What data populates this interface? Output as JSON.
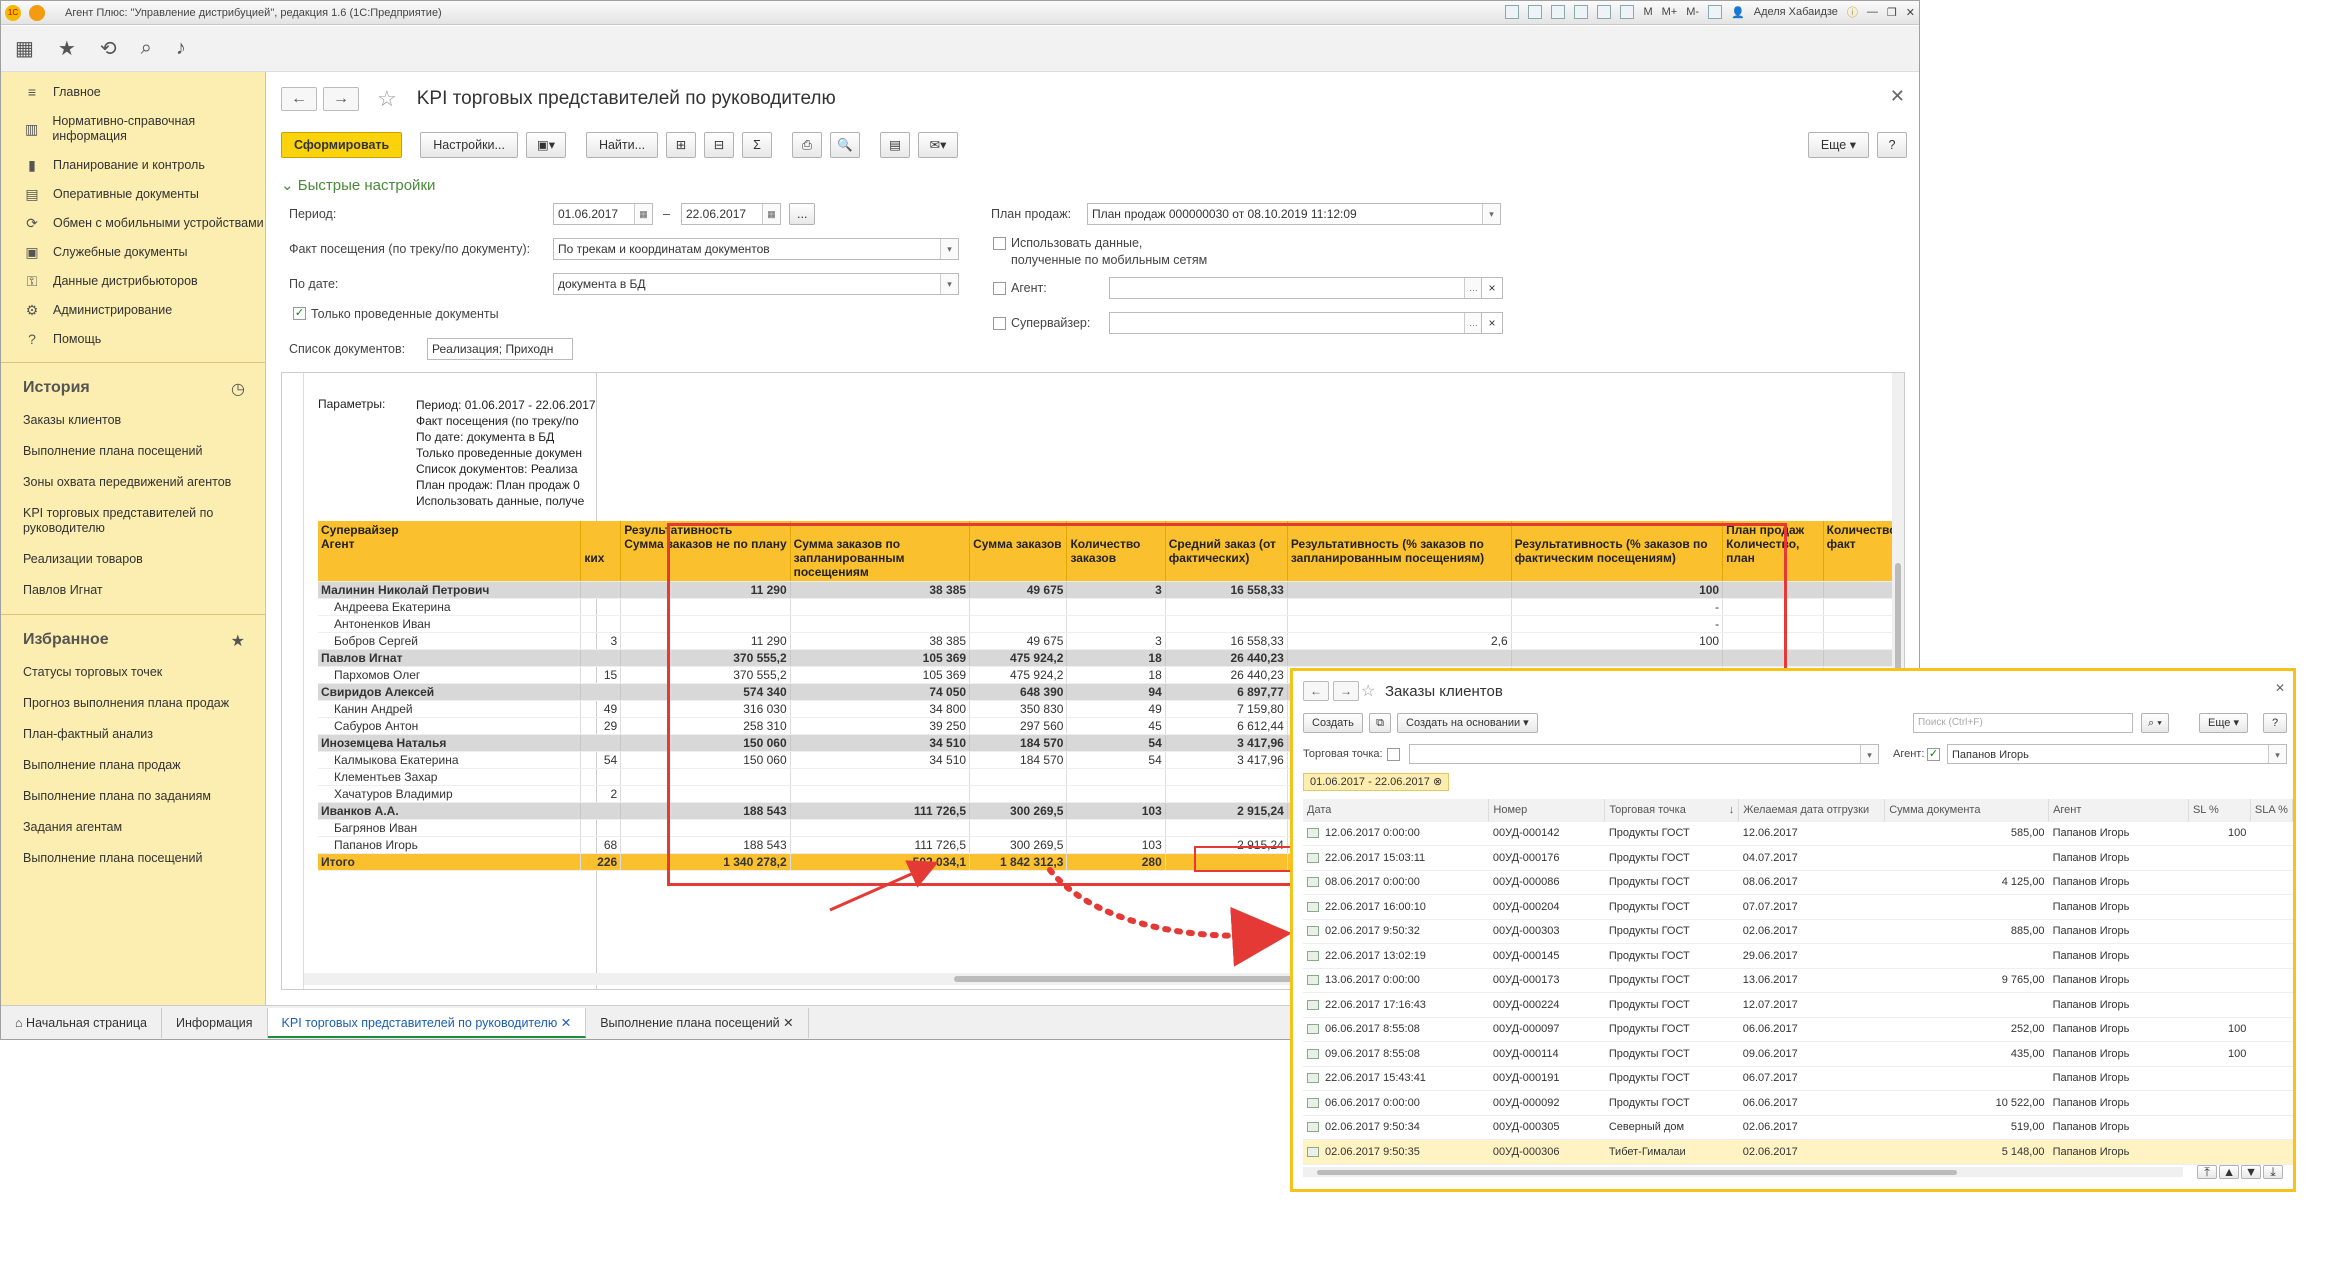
{
  "window": {
    "title": "Агент Плюс: \"Управление дистрибуцией\", редакция 1.6  (1С:Предприятие)",
    "user": "Аделя Хабаидзе",
    "toolbar_buttons": [
      "M",
      "M+",
      "M-"
    ]
  },
  "sidebar": {
    "sections": [
      {
        "label": "Главное",
        "icon": "menu-icon"
      },
      {
        "label": "Нормативно-справочная информация",
        "icon": "directory-icon"
      },
      {
        "label": "Планирование и контроль",
        "icon": "chart-icon"
      },
      {
        "label": "Оперативные документы",
        "icon": "document-icon"
      },
      {
        "label": "Обмен с мобильными устройствами",
        "icon": "sync-icon"
      },
      {
        "label": "Служебные документы",
        "icon": "service-icon"
      },
      {
        "label": "Данные дистрибьюторов",
        "icon": "data-icon"
      },
      {
        "label": "Администрирование",
        "icon": "gear-icon"
      },
      {
        "label": "Помощь",
        "icon": "help-icon"
      }
    ],
    "history_title": "История",
    "history": [
      "Заказы клиентов",
      "Выполнение плана посещений",
      "Зоны охвата передвижений агентов",
      "KPI торговых представителей по руководителю",
      "Реализации товаров",
      "Павлов Игнат"
    ],
    "favorites_title": "Избранное",
    "favorites": [
      "Статусы торговых точек",
      "Прогноз выполнения плана продаж",
      "План-фактный анализ",
      "Выполнение плана продаж",
      "Выполнение плана по заданиям",
      "Задания агентам",
      "Выполнение плана посещений"
    ]
  },
  "report_form": {
    "title": "KPI торговых представителей по руководителю",
    "buttons": {
      "generate": "Сформировать",
      "settings": "Настройки...",
      "find": "Найти...",
      "more": "Еще",
      "help": "?",
      "sum": "Σ"
    },
    "quick_settings": "Быстрые настройки",
    "period_label": "Период:",
    "period_from": "01.06.2017",
    "period_dash": "–",
    "period_to": "22.06.2017",
    "period_more": "...",
    "fact_label": "Факт посещения (по треку/по документу):",
    "fact_value": "По трекам и координатам документов",
    "bydate_label": "По дате:",
    "bydate_value": "документа в БД",
    "only_posted": "Только проведенные документы",
    "doclist_label": "Список документов:",
    "doclist_value": "Реализация; Приходн",
    "plan_label": "План продаж:",
    "plan_value": "План продаж 000000030 от 08.10.2019 11:12:09",
    "use_mobile": "Использовать данные,",
    "use_mobile2": "полученные по мобильным сетям",
    "agent_label": "Агент:",
    "supervisor_label": "Супервайзер:"
  },
  "report": {
    "params_label": "Параметры:",
    "params": [
      "Период: 01.06.2017 - 22.06.2017",
      "Факт посещения (по треку/по",
      "По дате: документа в БД",
      "Только проведенные докумен",
      "Список документов: Реализа",
      "План продаж: План продаж 0",
      "Использовать данные, получе"
    ],
    "headers": {
      "supervisor": "Супервайзер",
      "agent": "Агент",
      "col_kih": "ких",
      "results": "Результативность",
      "c1": "Сумма заказов не по плану",
      "c2": "Сумма заказов по запланированным посещениям",
      "c3": "Сумма заказов",
      "c4": "Количество заказов",
      "c5": "Средний заказ (от фактических)",
      "c6": "Результативность (% заказов по запланированным посещениям)",
      "c7": "Результативность (% заказов по фактическим посещениям)",
      "c8": "План продаж Количество, план",
      "c9": "Количество, факт"
    },
    "rows": [
      {
        "type": "grp",
        "name": "Малинин Николай Петрович",
        "k": "",
        "c1": "11 290",
        "c2": "38 385",
        "c3": "49 675",
        "c4": "3",
        "c5": "16 558,33",
        "c6": "",
        "c7": "100"
      },
      {
        "type": "row",
        "name": "Андреева Екатерина",
        "k": "",
        "c1": "",
        "c2": "",
        "c3": "",
        "c4": "",
        "c5": "",
        "c6": "",
        "c7": "-"
      },
      {
        "type": "row",
        "name": "Антоненков Иван",
        "k": "",
        "c1": "",
        "c2": "",
        "c3": "",
        "c4": "",
        "c5": "",
        "c6": "",
        "c7": "-"
      },
      {
        "type": "row",
        "name": "Бобров Сергей",
        "k": "3",
        "c1": "11 290",
        "c2": "38 385",
        "c3": "49 675",
        "c4": "3",
        "c5": "16 558,33",
        "c6": "2,6",
        "c7": "100"
      },
      {
        "type": "grp",
        "name": "Павлов Игнат",
        "k": "",
        "c1": "370 555,2",
        "c2": "105 369",
        "c3": "475 924,2",
        "c4": "18",
        "c5": "26 440,23",
        "c6": "",
        "c7": ""
      },
      {
        "type": "row",
        "name": "Пархомов Олег",
        "k": "15",
        "c1": "370 555,2",
        "c2": "105 369",
        "c3": "475 924,2",
        "c4": "18",
        "c5": "26 440,23",
        "c6": "",
        "c7": ""
      },
      {
        "type": "grp",
        "name": "Свиридов Алексей",
        "k": "",
        "c1": "574 340",
        "c2": "74 050",
        "c3": "648 390",
        "c4": "94",
        "c5": "6 897,77",
        "c6": "",
        "c7": ""
      },
      {
        "type": "row",
        "name": "Канин Андрей",
        "k": "49",
        "c1": "316 030",
        "c2": "34 800",
        "c3": "350 830",
        "c4": "49",
        "c5": "7 159,80",
        "c6": "",
        "c7": ""
      },
      {
        "type": "row",
        "name": "Сабуров Антон",
        "k": "29",
        "c1": "258 310",
        "c2": "39 250",
        "c3": "297 560",
        "c4": "45",
        "c5": "6 612,44",
        "c6": "",
        "c7": ""
      },
      {
        "type": "grp",
        "name": "Иноземцева Наталья",
        "k": "",
        "c1": "150 060",
        "c2": "34 510",
        "c3": "184 570",
        "c4": "54",
        "c5": "3 417,96",
        "c6": "",
        "c7": ""
      },
      {
        "type": "row",
        "name": "Калмыкова Екатерина",
        "k": "54",
        "c1": "150 060",
        "c2": "34 510",
        "c3": "184 570",
        "c4": "54",
        "c5": "3 417,96",
        "c6": "",
        "c7": ""
      },
      {
        "type": "row",
        "name": "Клементьев Захар",
        "k": "",
        "c1": "",
        "c2": "",
        "c3": "",
        "c4": "",
        "c5": "",
        "c6": "",
        "c7": ""
      },
      {
        "type": "row",
        "name": "Хачатуров Владимир",
        "k": "2",
        "c1": "",
        "c2": "",
        "c3": "",
        "c4": "",
        "c5": "",
        "c6": "",
        "c7": ""
      },
      {
        "type": "grp",
        "name": "Иванков А.А.",
        "k": "",
        "c1": "188 543",
        "c2": "111 726,5",
        "c3": "300 269,5",
        "c4": "103",
        "c5": "2 915,24",
        "c6": "",
        "c7": ""
      },
      {
        "type": "row",
        "name": "Багрянов Иван",
        "k": "",
        "c1": "",
        "c2": "",
        "c3": "",
        "c4": "",
        "c5": "",
        "c6": "",
        "c7": ""
      },
      {
        "type": "row",
        "name": "Папанов Игорь",
        "k": "68",
        "c1": "188 543",
        "c2": "111 726,5",
        "c3": "300 269,5",
        "c4": "103",
        "c5": "2 915,24",
        "c6": "",
        "c7": ""
      },
      {
        "type": "tot",
        "name": "Итого",
        "k": "226",
        "c1": "1 340 278,2",
        "c2": "502 034,1",
        "c3": "1 842 312,3",
        "c4": "280",
        "c5": "",
        "c6": "",
        "c7": ""
      }
    ]
  },
  "tabs": [
    "Начальная страница",
    "Информация",
    "KPI торговых представителей по руководителю",
    "Выполнение плана посещений"
  ],
  "orders": {
    "title": "Заказы клиентов",
    "create": "Создать",
    "create_basis": "Создать на основании",
    "search_placeholder": "Поиск (Ctrl+F)",
    "more": "Еще",
    "help": "?",
    "outlet_label": "Торговая точка:",
    "agent_label": "Агент:",
    "agent_value": "Папанов Игорь",
    "period_filter": "01.06.2017 - 22.06.2017",
    "columns": [
      "Дата",
      "Номер",
      "Торговая точка",
      "Желаемая дата отгрузки",
      "Сумма документа",
      "Агент",
      "SL %",
      "SLA %"
    ],
    "rows": [
      [
        "12.06.2017 0:00:00",
        "00УД-000142",
        "Продукты ГОСТ",
        "12.06.2017",
        "585,00",
        "Папанов Игорь",
        "100",
        ""
      ],
      [
        "22.06.2017 15:03:11",
        "00УД-000176",
        "Продукты ГОСТ",
        "04.07.2017",
        "",
        "Папанов Игорь",
        "",
        ""
      ],
      [
        "08.06.2017 0:00:00",
        "00УД-000086",
        "Продукты ГОСТ",
        "08.06.2017",
        "4 125,00",
        "Папанов Игорь",
        "",
        ""
      ],
      [
        "22.06.2017 16:00:10",
        "00УД-000204",
        "Продукты ГОСТ",
        "07.07.2017",
        "",
        "Папанов Игорь",
        "",
        ""
      ],
      [
        "02.06.2017 9:50:32",
        "00УД-000303",
        "Продукты ГОСТ",
        "02.06.2017",
        "885,00",
        "Папанов Игорь",
        "",
        ""
      ],
      [
        "22.06.2017 13:02:19",
        "00УД-000145",
        "Продукты ГОСТ",
        "29.06.2017",
        "",
        "Папанов Игорь",
        "",
        ""
      ],
      [
        "13.06.2017 0:00:00",
        "00УД-000173",
        "Продукты ГОСТ",
        "13.06.2017",
        "9 765,00",
        "Папанов Игорь",
        "",
        ""
      ],
      [
        "22.06.2017 17:16:43",
        "00УД-000224",
        "Продукты ГОСТ",
        "12.07.2017",
        "",
        "Папанов Игорь",
        "",
        ""
      ],
      [
        "06.06.2017 8:55:08",
        "00УД-000097",
        "Продукты ГОСТ",
        "06.06.2017",
        "252,00",
        "Папанов Игорь",
        "100",
        ""
      ],
      [
        "09.06.2017 8:55:08",
        "00УД-000114",
        "Продукты ГОСТ",
        "09.06.2017",
        "435,00",
        "Папанов Игорь",
        "100",
        ""
      ],
      [
        "22.06.2017 15:43:41",
        "00УД-000191",
        "Продукты ГОСТ",
        "06.07.2017",
        "",
        "Папанов Игорь",
        "",
        ""
      ],
      [
        "06.06.2017 0:00:00",
        "00УД-000092",
        "Продукты ГОСТ",
        "06.06.2017",
        "10 522,00",
        "Папанов Игорь",
        "",
        ""
      ],
      [
        "02.06.2017 9:50:34",
        "00УД-000305",
        "Северный дом",
        "02.06.2017",
        "519,00",
        "Папанов Игорь",
        "",
        ""
      ],
      [
        "02.06.2017 9:50:35",
        "00УД-000306",
        "Тибет-Гималаи",
        "02.06.2017",
        "5 148,00",
        "Папанов Игорь",
        "",
        ""
      ]
    ]
  },
  "colors": {
    "accent": "#fbc02d",
    "sidebar": "#fbeeb0",
    "highlight": "#e53935",
    "orders_border": "#f7c21a"
  }
}
